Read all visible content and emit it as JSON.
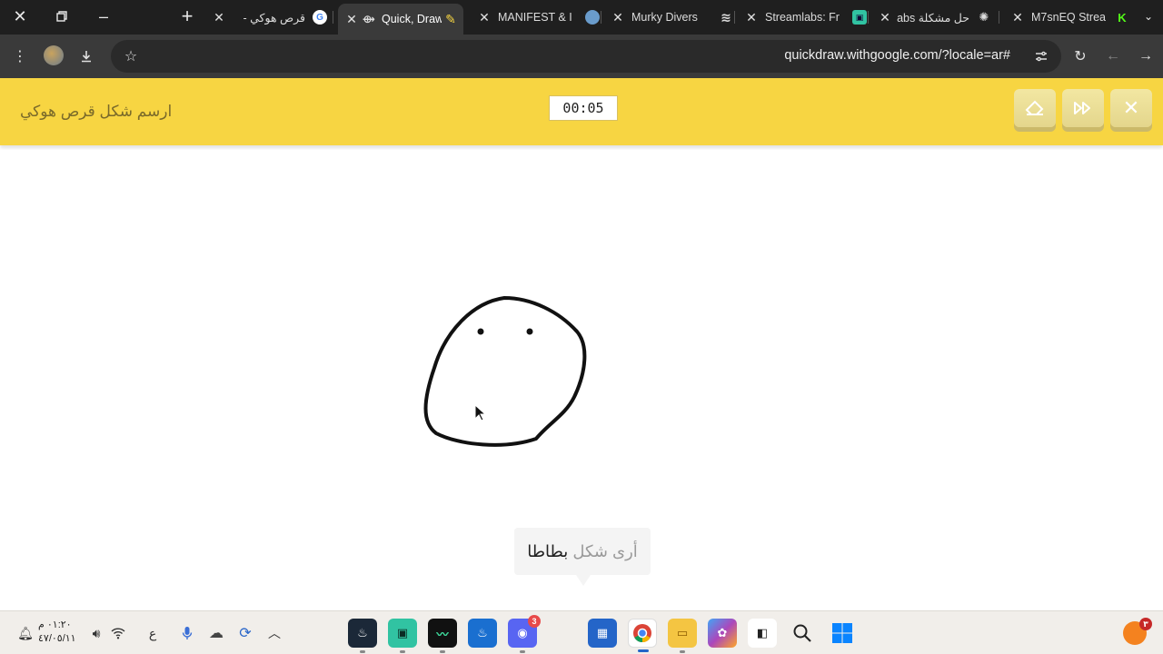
{
  "browser": {
    "tabs": [
      {
        "title": "قرص هوكي - ",
        "favicon": "google-icon",
        "active": false
      },
      {
        "title": "Quick, Draw!",
        "favicon": "quickdraw-icon",
        "active": true
      },
      {
        "title": "MANIFEST & I",
        "favicon": "circle-icon",
        "active": false
      },
      {
        "title": "Murky Divers",
        "favicon": "stack-icon",
        "active": false
      },
      {
        "title": "Streamlabs: Fr",
        "favicon": "streamlabs-icon",
        "active": false
      },
      {
        "title": "حل مشكلة abs",
        "favicon": "chatgpt-icon",
        "active": false
      },
      {
        "title": "M7snEQ Strea",
        "favicon": "kick-icon",
        "active": false
      }
    ],
    "new_tab": "+",
    "url": "quickdraw.withgoogle.com/?locale=ar#"
  },
  "game": {
    "prompt": "ارسم شكل قرص هوكي",
    "timer": "00:05",
    "guess_prefix": "أرى شكل",
    "guess_word": "بطاطا"
  },
  "taskbar": {
    "clock_time": "٠١:٢٠ م",
    "clock_date": "٤٧/٠٥/١١",
    "language": "ع",
    "discord_badge": "3",
    "notif_badge": "٣"
  },
  "colors": {
    "banner": "#f7d542",
    "tabstrip": "#1f1f1f",
    "toolbar": "#3a3a3a"
  }
}
